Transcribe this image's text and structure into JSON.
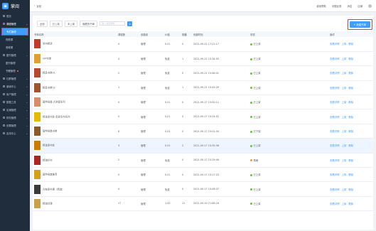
{
  "app": {
    "title": "掌阅"
  },
  "sidebar": {
    "items": [
      {
        "label": "首页",
        "level": 0
      },
      {
        "label": "课程管理",
        "level": 0,
        "active": true
      },
      {
        "label": "专栏管理",
        "level": 1,
        "selected": true
      },
      {
        "label": "视频课",
        "level": 1
      },
      {
        "label": "音频课",
        "level": 1
      },
      {
        "label": "图书管理",
        "level": 0
      },
      {
        "label": "图书管理",
        "level": 1
      },
      {
        "label": "书籍管理",
        "level": 1,
        "dot": true
      },
      {
        "label": "社群管理",
        "level": 0
      },
      {
        "label": "营销中心",
        "level": 0
      },
      {
        "label": "用户管理",
        "level": 0
      },
      {
        "label": "数据工具",
        "level": 0
      },
      {
        "label": "店铺管理",
        "level": 0
      },
      {
        "label": "财务管理",
        "level": 0
      },
      {
        "label": "设置管理",
        "level": 0
      },
      {
        "label": "应用中心",
        "level": 0
      }
    ]
  },
  "header": {
    "breadcrumb": "返回",
    "right": [
      "使用帮助",
      "问题反馈",
      "消息",
      "店铺"
    ]
  },
  "toolbar": {
    "filters": [
      "全部",
      "已上架",
      "未上架",
      "隐藏的书单"
    ],
    "search_placeholder": "输入书名搜索",
    "add_button": "+ 新建书单"
  },
  "table": {
    "headers": [
      "书单名称",
      "课程数",
      "创建者",
      "价格",
      "销量",
      "创建时间",
      "状态",
      "操作"
    ],
    "rows": [
      {
        "name": "读书精读",
        "count": "4",
        "creator": "管理",
        "price": "0.01",
        "sales": "0",
        "date": "2021-09-22 17:21:17",
        "status": "已上架",
        "status_color": "#67c23a",
        "cover": "#c0392b"
      },
      {
        "name": "VIP书单",
        "count": "4",
        "creator": "管理",
        "price": "免费",
        "sales": "1",
        "date": "2021-09-22 15:34:55",
        "status": "已上架",
        "status_color": "#67c23a",
        "cover": "#e0a030"
      },
      {
        "name": "精品书单01",
        "count": "2",
        "creator": "管理",
        "price": "免费",
        "sales": "0",
        "date": "2021-09-21 15:46:41",
        "status": "已上架",
        "status_color": "#67c23a",
        "cover": "#b7472a"
      },
      {
        "name": "精品书单02",
        "count": "1",
        "creator": "管理",
        "price": "免费",
        "sales": "1",
        "date": "2021-09-21 15:45:29",
        "status": "已上架",
        "status_color": "#67c23a",
        "cover": "#a0522d"
      },
      {
        "name": "国学经典·大讲堂系列",
        "count": "5",
        "creator": "管理",
        "price": "0.01",
        "sales": "0",
        "date": "2021-09-17 15:00:11",
        "status": "已上架",
        "status_color": "#67c23a",
        "cover": "#d98c6a"
      },
      {
        "name": "精选读书会·名家名作系列",
        "count": "5",
        "creator": "管理",
        "price": "0.01",
        "sales": "0",
        "date": "2021-09-17 15:24:02",
        "status": "已上架",
        "status_color": "#67c23a",
        "cover": "#e6b800"
      },
      {
        "name": "国学经典书单",
        "count": "6",
        "creator": "管理",
        "price": "0.01",
        "sales": "0",
        "date": "2021-09-17 15:01:34",
        "status": "已下架",
        "status_color": "#67c23a",
        "cover": "#8b5a2b"
      },
      {
        "name": "精选读书会",
        "count": "3",
        "creator": "管理",
        "price": "0.01",
        "sales": "2",
        "date": "2021-09-17 15:35:58",
        "status": "已上架",
        "status_color": "#67c23a",
        "cover": "#cc7a00"
      },
      {
        "name": "精选好书",
        "count": "2",
        "creator": "管理",
        "price": "免费",
        "sales": "0",
        "date": "2021-09-17 15:29:49",
        "status": "草稿",
        "status_color": "#e6a23c",
        "cover": "#b22222"
      },
      {
        "name": "国学经典推荐",
        "count": "5",
        "creator": "管理",
        "price": "0.01",
        "sales": "0",
        "date": "2021-09-17 15:17:23",
        "status": "已上架",
        "status_color": "#67c23a",
        "cover": "#d4a017"
      },
      {
        "name": "大咖读书课（精选）",
        "count": "4",
        "creator": "管理",
        "price": "免费",
        "sales": "0",
        "date": "2021-09-17 15:08:37",
        "status": "已上架",
        "status_color": "#67c23a",
        "cover": "#3a3a3a"
      },
      {
        "name": "精选好课",
        "count": "17",
        "creator": "管理",
        "price": "1.00",
        "sales": "11",
        "date": "2021-09-10 21:48:16",
        "status": "已上架",
        "status_color": "#67c23a",
        "cover": "#c8a24a"
      }
    ],
    "ops": [
      "查看详情",
      "上架",
      "删除"
    ]
  }
}
